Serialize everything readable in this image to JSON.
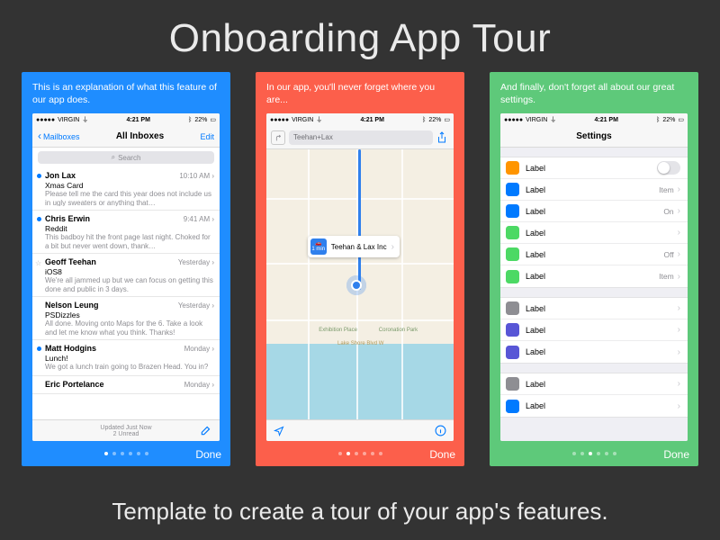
{
  "title": "Onboarding App Tour",
  "subtitle": "Template to create a tour of your app's features.",
  "statusbar": {
    "carrier": "VIRGIN",
    "wifi": "wifi",
    "time": "4:21 PM",
    "bt": "bt",
    "battery": "22%"
  },
  "footer": {
    "done": "Done"
  },
  "panels": [
    {
      "color": "blue",
      "blurb": "This is an explanation of what this feature of our app does.",
      "activeDot": 0,
      "mail": {
        "back": "Mailboxes",
        "title": "All Inboxes",
        "edit": "Edit",
        "searchPlaceholder": "Search",
        "updated": "Updated Just Now",
        "unreadCount": "2 Unread",
        "rows": [
          {
            "from": "Jon Lax",
            "time": "10:10 AM",
            "subject": "Xmas Card",
            "preview": "Please tell me the card this year does not include us in ugly sweaters or anything that…",
            "unread": true
          },
          {
            "from": "Chris Erwin",
            "time": "9:41 AM",
            "subject": "Reddit",
            "preview": "This badboy hit the front page last night. Choked for a bit but never went down, thank…",
            "unread": true
          },
          {
            "from": "Geoff Teehan",
            "time": "Yesterday",
            "subject": "iOS8",
            "preview": "We're all jammed up but we can focus on getting this done and public in 3 days.",
            "star": true
          },
          {
            "from": "Nelson Leung",
            "time": "Yesterday",
            "subject": "PSDizzles",
            "preview": "All done. Moving onto Maps for the 6. Take a look and let me know what you think. Thanks!"
          },
          {
            "from": "Matt Hodgins",
            "time": "Monday",
            "subject": "Lunch!",
            "preview": "We got a lunch train going to Brazen Head. You in?",
            "unread": true
          },
          {
            "from": "Eric Portelance",
            "time": "Monday",
            "subject": "",
            "preview": ""
          }
        ]
      }
    },
    {
      "color": "red",
      "blurb": "In our app, you'll never forget where you are...",
      "activeDot": 1,
      "maps": {
        "search": "Teehan+Lax",
        "callout": "Teehan & Lax Inc",
        "calloutTime": "1 min",
        "park1": "Exhibition Place",
        "park2": "Coronation Park",
        "road": "Lake Shore Blvd W"
      }
    },
    {
      "color": "green",
      "blurb": "And finally, don't forget all about our great settings.",
      "activeDot": 2,
      "settings": {
        "title": "Settings",
        "groups": [
          [
            {
              "icon": "#ff9500",
              "label": "Label",
              "type": "toggle"
            },
            {
              "icon": "#007aff",
              "label": "Label",
              "type": "value",
              "value": "Item"
            },
            {
              "icon": "#007aff",
              "label": "Label",
              "type": "value",
              "value": "On"
            },
            {
              "icon": "#4cd964",
              "label": "Label",
              "type": "chev"
            },
            {
              "icon": "#4cd964",
              "label": "Label",
              "type": "value",
              "value": "Off"
            },
            {
              "icon": "#4cd964",
              "label": "Label",
              "type": "value",
              "value": "Item"
            }
          ],
          [
            {
              "icon": "#8e8e93",
              "label": "Label",
              "type": "chev"
            },
            {
              "icon": "#5856d6",
              "label": "Label",
              "type": "chev"
            },
            {
              "icon": "#5856d6",
              "label": "Label",
              "type": "chev"
            }
          ],
          [
            {
              "icon": "#8e8e93",
              "label": "Label",
              "type": "chev"
            },
            {
              "icon": "#007aff",
              "label": "Label",
              "type": "chev"
            }
          ]
        ]
      }
    }
  ]
}
